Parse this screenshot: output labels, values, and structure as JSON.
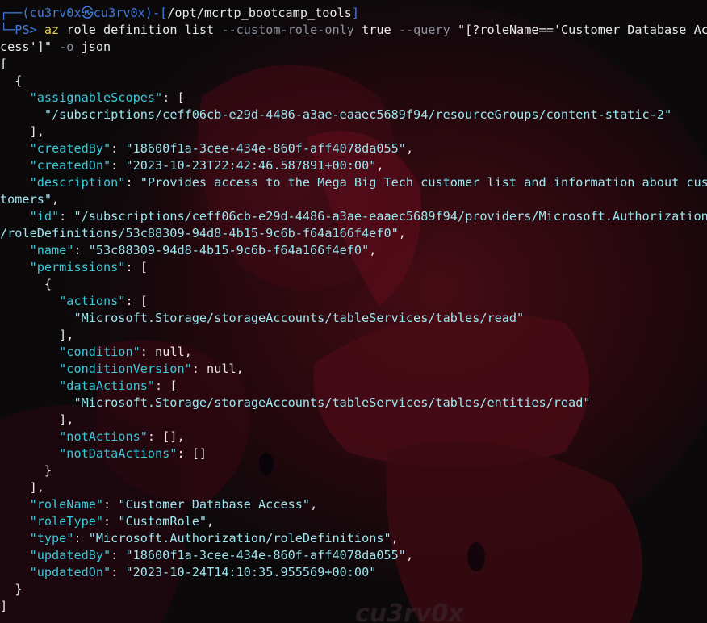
{
  "prompt": {
    "frame_top": "┌──(",
    "user": "cu3rv0x",
    "at_glyph": "㉿",
    "host": "cu3rv0x",
    "mid": ")-[",
    "path": "/opt/mcrtp_bootcamp_tools",
    "close": "]",
    "frame_bottom": "└─",
    "ps": "PS> "
  },
  "command": {
    "program": "az",
    "args": " role definition list ",
    "flag_custom": "--custom-role-only",
    "value_true": " true ",
    "flag_query": "--query",
    "query_part1": " \"[?roleName=='Customer Database Ac",
    "query_part2": "cess']\"",
    "flag_output": " -o",
    "output_value": " json"
  },
  "output": {
    "open_bracket": "[",
    "open_brace": "  {",
    "assignableScopes_key": "\"assignableScopes\"",
    "assignableScopes_value": "\"/subscriptions/ceff06cb-e29d-4486-a3ae-eaaec5689f94/resourceGroups/content-static-2\"",
    "createdBy_key": "\"createdBy\"",
    "createdBy_value": "\"18600f1a-3cee-434e-860f-aff4078da055\"",
    "createdOn_key": "\"createdOn\"",
    "createdOn_value": "\"2023-10-23T22:42:46.587891+00:00\"",
    "description_key": "\"description\"",
    "description_value_part1": "\"Provides access to the Mega Big Tech customer list and information about cus",
    "description_value_part2": "tomers\"",
    "id_key": "\"id\"",
    "id_value_part1": "\"/subscriptions/ceff06cb-e29d-4486-a3ae-eaaec5689f94/providers/Microsoft.Authorization",
    "id_value_part2": "/roleDefinitions/53c88309-94d8-4b15-9c6b-f64a166f4ef0\"",
    "name_key": "\"name\"",
    "name_value": "\"53c88309-94d8-4b15-9c6b-f64a166f4ef0\"",
    "permissions_key": "\"permissions\"",
    "actions_key": "\"actions\"",
    "actions_value": "\"Microsoft.Storage/storageAccounts/tableServices/tables/read\"",
    "condition_key": "\"condition\"",
    "condition_value": "null",
    "conditionVersion_key": "\"conditionVersion\"",
    "conditionVersion_value": "null",
    "dataActions_key": "\"dataActions\"",
    "dataActions_value": "\"Microsoft.Storage/storageAccounts/tableServices/tables/entities/read\"",
    "notActions_key": "\"notActions\"",
    "notActions_value": "[]",
    "notDataActions_key": "\"notDataActions\"",
    "notDataActions_value": "[]",
    "roleName_key": "\"roleName\"",
    "roleName_value": "\"Customer Database Access\"",
    "roleType_key": "\"roleType\"",
    "roleType_value": "\"CustomRole\"",
    "type_key": "\"type\"",
    "type_value": "\"Microsoft.Authorization/roleDefinitions\"",
    "updatedBy_key": "\"updatedBy\"",
    "updatedBy_value": "\"18600f1a-3cee-434e-860f-aff4078da055\"",
    "updatedOn_key": "\"updatedOn\"",
    "updatedOn_value": "\"2023-10-24T14:10:35.955569+00:00\"",
    "close_brace": "  }",
    "close_bracket": "]"
  },
  "wallpaper": {
    "watermark_text": "cu3rv0x",
    "colors": {
      "background": "#0d0a0c",
      "glow": "#6a0f1c",
      "mask": "#3a0a12"
    }
  },
  "colors": {
    "key": "#37c9d9",
    "string_value": "#9be6ee",
    "prompt": "#3f7bd8",
    "command": "#e3d14a",
    "flag": "#8a8f9c",
    "text": "#e8e8ea"
  }
}
